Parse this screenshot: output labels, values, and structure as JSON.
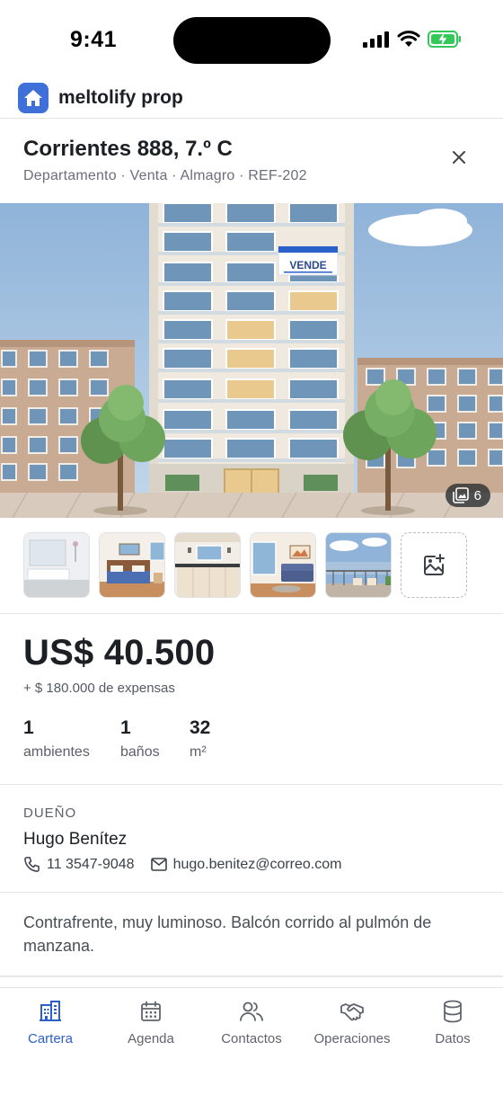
{
  "status_bar": {
    "time": "9:41"
  },
  "app": {
    "name": "meltolify prop",
    "logo_icon": "home-icon",
    "accent": "#3f6fd8"
  },
  "property": {
    "title": "Corrientes 888, 7.º C",
    "subtitle": "Departamento · Venta · Almagro · REF-202",
    "sign_text": "VENDE",
    "photo_count": "6",
    "thumbnails": [
      "bathroom",
      "bedroom",
      "kitchen",
      "living-room",
      "balcony"
    ],
    "price": "US$ 40.500",
    "expenses": "+ $ 180.000 de expensas",
    "stats": [
      {
        "value": "1",
        "label": "ambientes"
      },
      {
        "value": "1",
        "label": "baños"
      },
      {
        "value": "32",
        "label": "m²"
      }
    ],
    "owner": {
      "section_label": "DUEÑO",
      "name": "Hugo Benítez",
      "phone": "11 3547-9048",
      "email": "hugo.benitez@correo.com"
    },
    "description": "Contrafrente, muy luminoso. Balcón corrido al pulmón de manzana."
  },
  "nav": {
    "items": [
      {
        "label": "Cartera",
        "icon": "building-icon",
        "active": true
      },
      {
        "label": "Agenda",
        "icon": "calendar-icon",
        "active": false
      },
      {
        "label": "Contactos",
        "icon": "users-icon",
        "active": false
      },
      {
        "label": "Operaciones",
        "icon": "handshake-icon",
        "active": false
      },
      {
        "label": "Datos",
        "icon": "database-icon",
        "active": false
      }
    ],
    "active_color": "#2b5fc9"
  }
}
